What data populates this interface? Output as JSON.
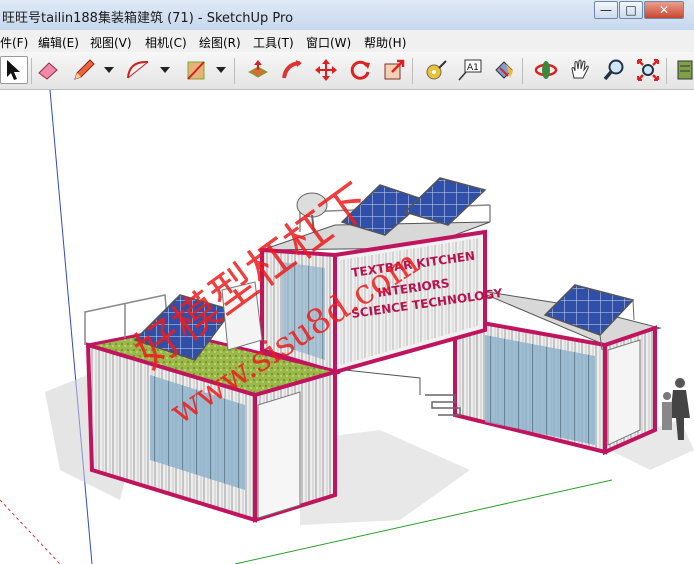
{
  "window": {
    "title": "旺旺号tailin188集装箱建筑 (71) - SketchUp Pro",
    "minimize_glyph": "—",
    "maximize_glyph": "□",
    "close_glyph": "✕"
  },
  "menu": [
    "件(F)",
    "编辑(E)",
    "视图(V)",
    "相机(C)",
    "绘图(R)",
    "工具(T)",
    "窗口(W)",
    "帮助(H)"
  ],
  "toolbar": {
    "tools": [
      "select-icon",
      "eraser-icon",
      "pencil-icon",
      "arc-icon",
      "rectangle-icon",
      "push-pull-icon",
      "follow-me-icon",
      "move-icon",
      "rotate-icon",
      "scale-icon",
      "tape-measure-icon",
      "text-icon",
      "paint-bucket-icon",
      "orbit-icon",
      "pan-icon",
      "zoom-icon",
      "zoom-extents-icon",
      "component-icon"
    ],
    "text_tool_label": "A1"
  },
  "scene": {
    "signage": [
      "TEXTBAR KITCHEN",
      "INTERIORS",
      "SCIENCE TECHNOLOGY"
    ],
    "watermark": "好模型杠杠下",
    "watermark_url": "www.sisu8d.com",
    "colors": {
      "container_frame": "#c0155e",
      "grass": "#9ab84a",
      "solar": "#2f4fa8",
      "watermark": "#ee1c1c"
    }
  }
}
